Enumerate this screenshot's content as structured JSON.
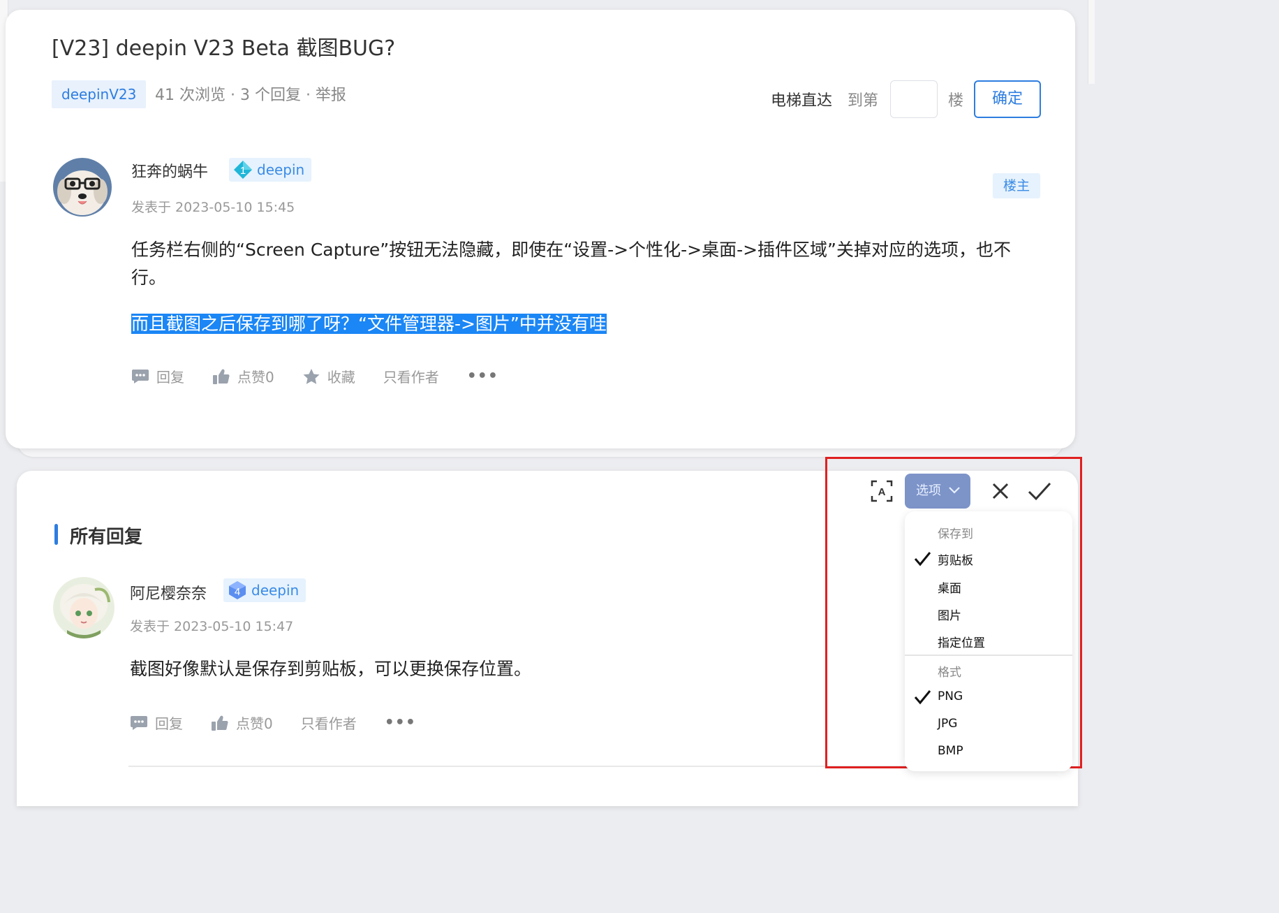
{
  "post": {
    "title": "[V23] deepin V23 Beta 截图BUG?",
    "tag": "deepinV23",
    "stats": "41 次浏览 · 3 个回复 · 举报",
    "elevator": {
      "label": "电梯直达",
      "to": "到第",
      "unit": "楼",
      "confirm": "确定",
      "floor_value": ""
    },
    "author": {
      "name": "狂奔的蜗牛",
      "level": "1",
      "level_name": "deepin",
      "time": "发表于 2023-05-10 15:45",
      "op_badge": "楼主"
    },
    "body_p1": "任务栏右侧的“Screen Capture”按钮无法隐藏，即使在“设置->个性化->桌面->插件区域”关掉对应的选项，也不行。",
    "body_p2": "而且截图之后保存到哪了呀？“文件管理器->图片”中并没有哇",
    "actions": {
      "reply": "回复",
      "like": "点赞0",
      "favorite": "收藏",
      "author_only": "只看作者",
      "more": "•••"
    }
  },
  "replies": {
    "section_title": "所有回复",
    "items": [
      {
        "name": "阿尼樱奈奈",
        "level": "4",
        "level_name": "deepin",
        "time": "发表于 2023-05-10 15:47",
        "body": "截图好像默认是保存到剪贴板，可以更换保存位置。",
        "actions": {
          "reply": "回复",
          "like": "点赞0",
          "author_only": "只看作者",
          "more": "•••"
        }
      }
    ]
  },
  "capture_toolbar": {
    "options_label": "选项",
    "icons": [
      "ocr-icon",
      "chevron-down-icon",
      "close-icon",
      "checkmark-icon"
    ],
    "menu": {
      "save_group": "保存到",
      "save_items": [
        "剪贴板",
        "桌面",
        "图片",
        "指定位置"
      ],
      "save_selected": "剪贴板",
      "format_group": "格式",
      "format_items": [
        "PNG",
        "JPG",
        "BMP"
      ],
      "format_selected": "PNG"
    }
  },
  "colors": {
    "accent": "#2d7de0",
    "selection": "#1b86f5",
    "highlight_frame": "#e02020",
    "options_button": "#7d94c9"
  }
}
